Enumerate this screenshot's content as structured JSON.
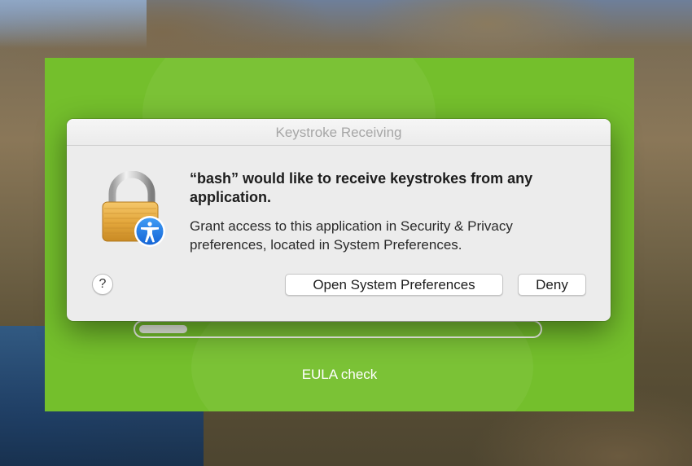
{
  "installer": {
    "status_label": "EULA check",
    "progress_fraction": 0.12,
    "accent_color": "#74bf2c"
  },
  "dialog": {
    "title": "Keystroke Receiving",
    "headline": "“bash” would like to receive keystrokes from any application.",
    "body": "Grant access to this application in Security & Privacy preferences, located in System Preferences.",
    "help_label": "?",
    "open_prefs_label": "Open System Preferences",
    "deny_label": "Deny",
    "icon": "lock-accessibility-icon"
  }
}
